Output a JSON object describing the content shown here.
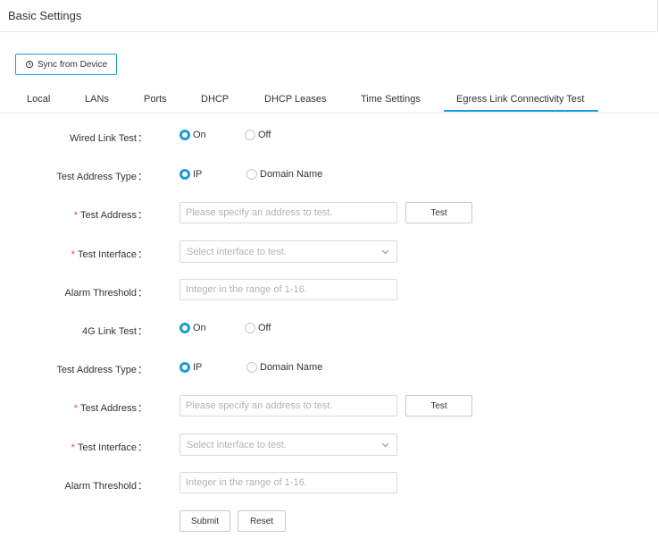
{
  "header": {
    "title": "Basic Settings"
  },
  "toolbar": {
    "sync_label": "Sync from Device"
  },
  "tabs": [
    {
      "label": "Local"
    },
    {
      "label": "LANs"
    },
    {
      "label": "Ports"
    },
    {
      "label": "DHCP"
    },
    {
      "label": "DHCP Leases"
    },
    {
      "label": "Time Settings"
    },
    {
      "label": "Egress Link Connectivity Test"
    }
  ],
  "wired": {
    "link_test_label": "Wired Link Test",
    "on_label": "On",
    "off_label": "Off",
    "link_test_value": "On",
    "addr_type_label": "Test Address Type",
    "ip_label": "IP",
    "domain_label": "Domain Name",
    "addr_type_value": "IP",
    "address_label": "Test Address",
    "address_placeholder": "Please specify an address to test.",
    "test_button": "Test",
    "interface_label": "Test Interface",
    "interface_placeholder": "Select interface to test.",
    "alarm_label": "Alarm Threshold",
    "alarm_placeholder": "Integer in the range of 1-16."
  },
  "lte": {
    "link_test_label": "4G Link Test",
    "on_label": "On",
    "off_label": "Off",
    "link_test_value": "On",
    "addr_type_label": "Test Address Type",
    "ip_label": "IP",
    "domain_label": "Domain Name",
    "addr_type_value": "IP",
    "address_label": "Test Address",
    "address_placeholder": "Please specify an address to test.",
    "test_button": "Test",
    "interface_label": "Test Interface",
    "interface_placeholder": "Select interface to test.",
    "alarm_label": "Alarm Threshold",
    "alarm_placeholder": "Integer in the range of 1-16."
  },
  "form": {
    "colon": "：",
    "required_mark": "*",
    "submit_label": "Submit",
    "reset_label": "Reset"
  },
  "colors": {
    "accent": "#1d9ad6",
    "required": "#e64545"
  },
  "icons": {
    "sync": "sync-icon",
    "chevron": "chevron-down-icon"
  }
}
